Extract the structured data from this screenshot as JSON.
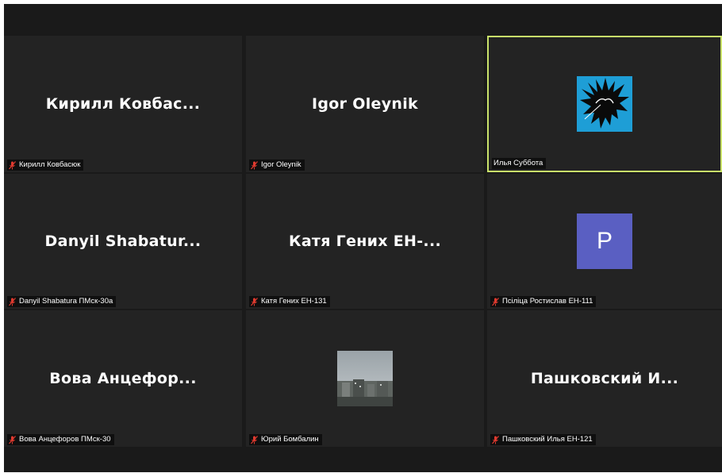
{
  "meeting": {
    "tiles": [
      {
        "big_name": "Кирилл  Ковбас...",
        "label": "Кирилл Ковбасюк",
        "muted": true
      },
      {
        "big_name": "Igor Oleynik",
        "label": "Igor Oleynik",
        "muted": true
      },
      {
        "big_name": "",
        "label": "Илья Суббота",
        "muted": false,
        "active_speaker": true,
        "avatar": "spiky-hair-silhouette-image"
      },
      {
        "big_name": "Danyil  Shabatur...",
        "label": "Danyil Shabatura ПМск-30а",
        "muted": true
      },
      {
        "big_name": "Катя  Гених  ЕН-...",
        "label": "Катя Гених ЕН-131",
        "muted": true
      },
      {
        "big_name": "",
        "label": "Псіліца Ростислав ЕН-111",
        "muted": true,
        "avatar_letter": "P"
      },
      {
        "big_name": "Вова  Анцефор...",
        "label": "Вова Анцефоров ПМск-30",
        "muted": true
      },
      {
        "big_name": "",
        "label": "Юрий Бомбалин",
        "muted": true,
        "avatar": "city-photo-image"
      },
      {
        "big_name": "Пашковский  И...",
        "label": "Пашковский Илья ЕН-121",
        "muted": true
      }
    ]
  },
  "colors": {
    "background": "#1a1a1a",
    "tile": "#232323",
    "active_border": "#c9e26a",
    "mute_icon": "#e03a2f",
    "avatar_letter_bg": "#5a5fc2",
    "avatar_spiky_bg": "#1e9ed6"
  },
  "icons": {
    "mute": "muted-mic-icon"
  }
}
